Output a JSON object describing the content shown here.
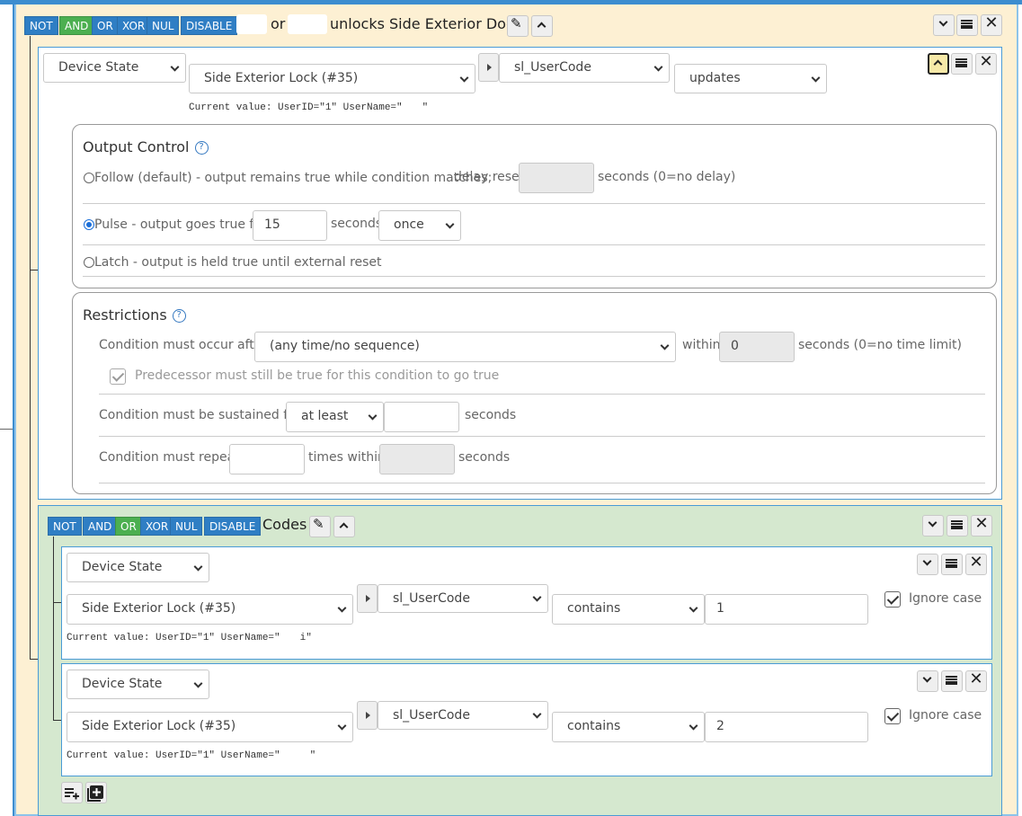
{
  "group": {
    "ops": [
      "NOT",
      "AND",
      "OR",
      "XOR",
      "NUL",
      "DISABLE"
    ],
    "active_op": "AND",
    "name_join": "or",
    "name": "unlocks Side Exterior Door"
  },
  "cond1": {
    "type": "Device State",
    "device": "Side Exterior Lock (#35)",
    "variable": "sl_UserCode",
    "operator": "updates",
    "current_value": "Current value: UserID=\"1\" UserName=\"  \""
  },
  "output_control": {
    "title": "Output Control",
    "follow_label": "Follow (default) - output remains true while condition matches;",
    "delay_reset_label": "delay reset",
    "delay_reset_value": "",
    "delay_reset_unit": "seconds (0=no delay)",
    "pulse_label": "Pulse - output goes true for",
    "pulse_value": "15",
    "pulse_unit": "seconds",
    "pulse_mode": "once",
    "latch_label": "Latch - output is held true until external reset",
    "selected": "pulse"
  },
  "restrictions": {
    "title": "Restrictions",
    "after_label": "Condition must occur after",
    "after_value": "(any time/no sequence)",
    "within_label": "within",
    "within_value": "0",
    "within_unit": "seconds (0=no time limit)",
    "predecessor_label": "Predecessor must still be true for this condition to go true",
    "sustained_label": "Condition must be sustained for",
    "sustained_mode": "at least",
    "sustained_value": "",
    "sustained_unit": "seconds",
    "repeat_label": "Condition must repeat",
    "repeat_value": "",
    "repeat_mid": "times within",
    "repeat_within_value": "",
    "repeat_unit": "seconds"
  },
  "subgroup": {
    "ops": [
      "NOT",
      "AND",
      "OR",
      "XOR",
      "NUL",
      "DISABLE"
    ],
    "active_op": "OR",
    "name": "Codes"
  },
  "sub_conditions": [
    {
      "type": "Device State",
      "device": "Side Exterior Lock (#35)",
      "variable": "sl_UserCode",
      "operator": "contains",
      "value": "1",
      "ignore_case_label": "Ignore case",
      "current_value": "Current value: UserID=\"1\" UserName=\"  i\""
    },
    {
      "type": "Device State",
      "device": "Side Exterior Lock (#35)",
      "variable": "sl_UserCode",
      "operator": "contains",
      "value": "2",
      "ignore_case_label": "Ignore case",
      "current_value": "Current value: UserID=\"1\" UserName=\"   \""
    }
  ],
  "colors": {
    "accent_blue": "#2f7ec4",
    "active_green": "#4caf50",
    "group_bg": "#fdf0d3",
    "subgroup_bg": "#d5e8cf"
  },
  "icons": [
    "pencil-icon",
    "chevron-up-icon",
    "chevron-down-icon",
    "menu-icon",
    "close-icon",
    "add-condition-icon",
    "add-group-icon",
    "help-icon",
    "triangle-right-icon"
  ]
}
